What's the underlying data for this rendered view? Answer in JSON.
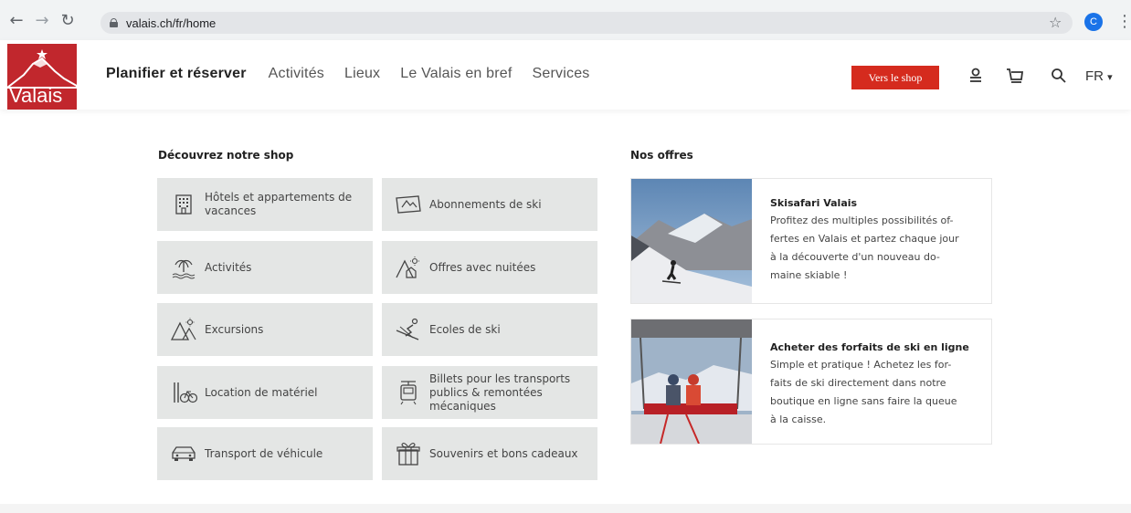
{
  "browser": {
    "url": "valais.ch/fr/home",
    "profile_initial": "C"
  },
  "logo": {
    "text": "Valais"
  },
  "nav": {
    "items": [
      "Planifier et réserver",
      "Activités",
      "Lieux",
      "Le Valais en bref",
      "Services"
    ]
  },
  "header": {
    "shop_button": "Vers le shop",
    "language": "FR"
  },
  "shop": {
    "title": "Découvrez notre shop",
    "tiles": [
      {
        "label": "Hôtels et appartements de vacances",
        "icon": "hotel-icon"
      },
      {
        "label": "Abonnements de ski",
        "icon": "ski-pass-icon"
      },
      {
        "label": "Activités",
        "icon": "activities-icon"
      },
      {
        "label": "Offres avec nuitées",
        "icon": "overnight-offers-icon"
      },
      {
        "label": "Excursions",
        "icon": "excursion-icon"
      },
      {
        "label": "Ecoles de ski",
        "icon": "ski-school-icon"
      },
      {
        "label": "Location de matériel",
        "icon": "equipment-rental-icon"
      },
      {
        "label": "Billets pour les transports publics & remontées mécaniques",
        "icon": "transport-tickets-icon"
      },
      {
        "label": "Transport de véhicule",
        "icon": "car-icon"
      },
      {
        "label": "Souvenirs et bons cadeaux",
        "icon": "gift-icon"
      }
    ]
  },
  "offers": {
    "title": "Nos offres",
    "items": [
      {
        "title": "Skisafari Valais",
        "desc_lines": [
          "Profitez des multiples possibilités of-",
          "fertes en Valais et partez chaque jour",
          "à la découverte d'un nouveau do-",
          "maine skiable !"
        ]
      },
      {
        "title": "Acheter des forfaits de ski en ligne",
        "desc_lines": [
          "Simple et pratique ! Achetez les for-",
          "faits de ski directement dans notre",
          "boutique en ligne sans faire la queue",
          "à la caisse."
        ]
      }
    ]
  },
  "colors": {
    "brand_red": "#c1272d",
    "button_red": "#d52b1e",
    "tile_bg": "#e4e6e5"
  }
}
